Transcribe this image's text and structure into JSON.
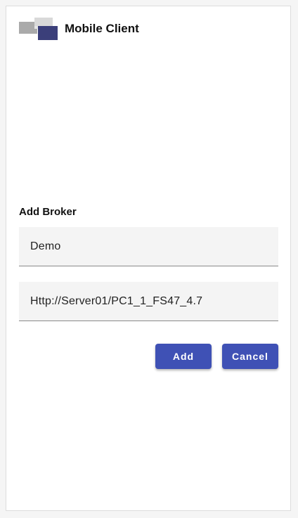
{
  "header": {
    "app_name": "Mobile Client",
    "logo_icon": "app-logo-icon"
  },
  "form": {
    "section_title": "Add Broker",
    "broker_name_value": "Demo",
    "broker_url_value": "Http://Server01/PC1_1_FS47_4.7"
  },
  "actions": {
    "add_label": "Add",
    "cancel_label": "Cancel"
  },
  "colors": {
    "primary": "#3f51b5",
    "logo_dark": "#3b3f7a",
    "field_bg": "#f4f4f4"
  }
}
